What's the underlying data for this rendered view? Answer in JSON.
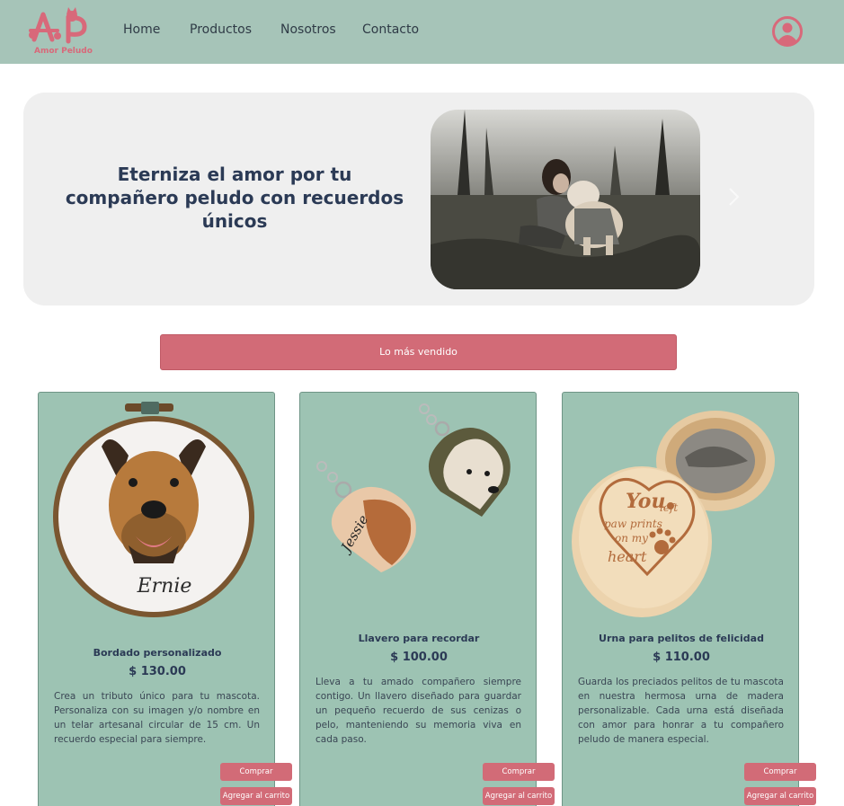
{
  "brand": {
    "logo_letters": "AP",
    "name": "Amor Peludo",
    "color": "#d8697a"
  },
  "nav": {
    "items": [
      "Home",
      "Productos",
      "Nosotros",
      "Contacto"
    ],
    "user_icon": "user-circle-icon"
  },
  "hero": {
    "title": "Eterniza el amor por tu compañero peludo con recuerdos únicos",
    "next_icon": "chevron-right-icon"
  },
  "best_seller": {
    "label": "Lo más vendido"
  },
  "products": [
    {
      "title": "Bordado personalizado",
      "price": "$ 130.00",
      "description": "Crea un tributo único para tu mascota. Personaliza con su imagen y/o nombre en un telar artesanal circular de 15 cm. Un recuerdo especial para siempre.",
      "embroidery_name": "Ernie",
      "buy_label": "Comprar",
      "cart_label": "Agregar al carrito"
    },
    {
      "title": "Llavero para recordar",
      "price": "$ 100.00",
      "description": "Lleva a tu amado compañero siempre contigo. Un llavero diseñado para guardar un pequeño recuerdo de sus cenizas o pelo, manteniendo su memoria viva en cada paso.",
      "engraving": "Jessie",
      "buy_label": "Comprar",
      "cart_label": "Agregar al carrito"
    },
    {
      "title": "Urna para pelitos de felicidad",
      "price": "$ 110.00",
      "description": "Guarda los preciados pelitos de tu mascota en nuestra hermosa urna de madera personalizable. Cada urna está diseñada con amor para honrar a tu compañero peludo de manera especial.",
      "engraving": [
        "You",
        "left",
        "paw prints",
        "on my",
        "heart"
      ],
      "buy_label": "Comprar",
      "cart_label": "Agregar al carrito"
    }
  ],
  "colors": {
    "navbar": "#a6c4b8",
    "accent": "#d26b77",
    "card": "#9dc3b3",
    "hero_bg": "#efefef",
    "text_dark": "#2b3a55"
  }
}
